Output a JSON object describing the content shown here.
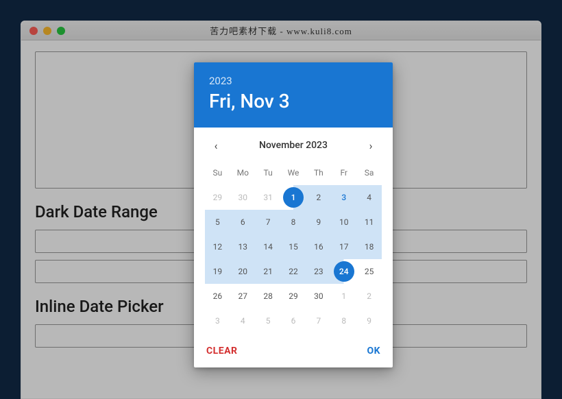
{
  "window": {
    "title": "苦力吧素材下载 - www.kuli8.com"
  },
  "sections": {
    "dark_range_title": "Dark Date Range",
    "inline_title": "Inline Date Picker"
  },
  "datepicker": {
    "header_year": "2023",
    "header_date": "Fri, Nov 3",
    "month_label": "November  2023",
    "dow": [
      "Su",
      "Mo",
      "Tu",
      "We",
      "Th",
      "Fr",
      "Sa"
    ],
    "weeks": [
      [
        {
          "n": 29,
          "other": true
        },
        {
          "n": 30,
          "other": true
        },
        {
          "n": 31,
          "other": true
        },
        {
          "n": 1,
          "selected": true,
          "range": "start"
        },
        {
          "n": 2,
          "range": "in"
        },
        {
          "n": 3,
          "range": "in",
          "today": true
        },
        {
          "n": 4,
          "range": "in"
        }
      ],
      [
        {
          "n": 5,
          "range": "in"
        },
        {
          "n": 6,
          "range": "in"
        },
        {
          "n": 7,
          "range": "in"
        },
        {
          "n": 8,
          "range": "in"
        },
        {
          "n": 9,
          "range": "in"
        },
        {
          "n": 10,
          "range": "in"
        },
        {
          "n": 11,
          "range": "in"
        }
      ],
      [
        {
          "n": 12,
          "range": "in"
        },
        {
          "n": 13,
          "range": "in"
        },
        {
          "n": 14,
          "range": "in"
        },
        {
          "n": 15,
          "range": "in"
        },
        {
          "n": 16,
          "range": "in"
        },
        {
          "n": 17,
          "range": "in"
        },
        {
          "n": 18,
          "range": "in"
        }
      ],
      [
        {
          "n": 19,
          "range": "in"
        },
        {
          "n": 20,
          "range": "in"
        },
        {
          "n": 21,
          "range": "in"
        },
        {
          "n": 22,
          "range": "in"
        },
        {
          "n": 23,
          "range": "in"
        },
        {
          "n": 24,
          "selected": true,
          "range": "end"
        },
        {
          "n": 25
        }
      ],
      [
        {
          "n": 26
        },
        {
          "n": 27
        },
        {
          "n": 28
        },
        {
          "n": 29
        },
        {
          "n": 30
        },
        {
          "n": 1,
          "other": true
        },
        {
          "n": 2,
          "other": true
        }
      ],
      [
        {
          "n": 3,
          "other": true
        },
        {
          "n": 4,
          "other": true
        },
        {
          "n": 5,
          "other": true
        },
        {
          "n": 6,
          "other": true
        },
        {
          "n": 7,
          "other": true
        },
        {
          "n": 8,
          "other": true
        },
        {
          "n": 9,
          "other": true
        }
      ]
    ],
    "actions": {
      "clear": "CLEAR",
      "ok": "OK"
    }
  }
}
